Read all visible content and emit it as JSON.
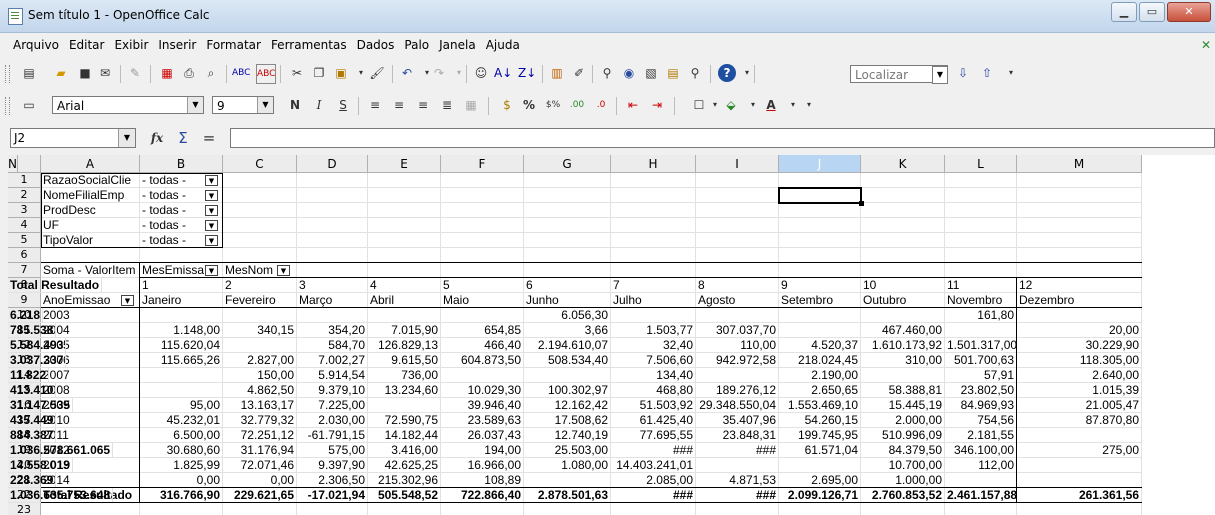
{
  "window": {
    "title": "Sem título 1 - OpenOffice Calc",
    "min": "▁",
    "max": "▭",
    "close": "✕"
  },
  "menu": [
    "Arquivo",
    "Editar",
    "Exibir",
    "Inserir",
    "Formatar",
    "Ferramentas",
    "Dados",
    "Palo",
    "Janela",
    "Ajuda"
  ],
  "toolbar": {
    "find_placeholder": "Localizar",
    "font_name": "Arial",
    "font_size": "9"
  },
  "formula": {
    "cell_ref": "J2",
    "content": ""
  },
  "columns": [
    "A",
    "B",
    "C",
    "D",
    "E",
    "F",
    "G",
    "H",
    "I",
    "J",
    "K",
    "L",
    "M",
    "N"
  ],
  "selected_column": "J",
  "filters": [
    {
      "label": "RazaoSocialClie",
      "value": "- todas -"
    },
    {
      "label": "NomeFilialEmp",
      "value": "- todas -"
    },
    {
      "label": "ProdDesc",
      "value": "- todas -"
    },
    {
      "label": "UF",
      "value": "- todas -"
    },
    {
      "label": "TipoValor",
      "value": "- todas -"
    }
  ],
  "pivot": {
    "data_label": "Soma - ValorItem",
    "col_field1": "MesEmissa",
    "col_field2": "MesNom",
    "row_field": "AnoEmissao",
    "month_numbers": [
      "1",
      "2",
      "3",
      "4",
      "5",
      "6",
      "7",
      "8",
      "9",
      "10",
      "11",
      "12"
    ],
    "month_names": [
      "Janeiro",
      "Fevereiro",
      "Março",
      "Abril",
      "Maio",
      "Junho",
      "Julho",
      "Agosto",
      "Setembro",
      "Outubro",
      "Novembro",
      "Dezembro"
    ],
    "total_header": "Total Resultado",
    "rows": [
      {
        "year": "2003",
        "values": [
          "",
          "",
          "",
          "",
          "",
          "6.056,30",
          "",
          "",
          "",
          "",
          "161,80",
          ""
        ],
        "total": "6.218"
      },
      {
        "year": "2004",
        "values": [
          "1.148,00",
          "340,15",
          "354,20",
          "7.015,90",
          "654,85",
          "3,66",
          "1.503,77",
          "307.037,70",
          "",
          "467.460,00",
          "",
          "20,00"
        ],
        "total": "785.538"
      },
      {
        "year": "2005",
        "values": [
          "115.620,04",
          "",
          "584,70",
          "126.829,13",
          "466,40",
          "2.194.610,07",
          "32,40",
          "110,00",
          "4.520,37",
          "1.610.173,92",
          "1.501.317,00",
          "30.229,90"
        ],
        "total": "5.584.493"
      },
      {
        "year": "2006",
        "values": [
          "115.665,26",
          "2.827,00",
          "7.002,27",
          "9.615,50",
          "604.873,50",
          "508.534,40",
          "7.506,60",
          "942.972,58",
          "218.024,45",
          "310,00",
          "501.700,63",
          "118.305,00"
        ],
        "total": "3.037.337"
      },
      {
        "year": "2007",
        "values": [
          "",
          "150,00",
          "5.914,54",
          "736,00",
          "",
          "",
          "134,40",
          "",
          "2.190,00",
          "",
          "57,91",
          "2.640,00"
        ],
        "total": "11.822"
      },
      {
        "year": "2008",
        "values": [
          "",
          "4.862,50",
          "9.379,10",
          "13.234,60",
          "10.029,30",
          "100.302,97",
          "468,80",
          "189.276,12",
          "2.650,65",
          "58.388,81",
          "23.802,50",
          "1.015,39"
        ],
        "total": "413.410"
      },
      {
        "year": "2009",
        "values": [
          "95,00",
          "13.163,17",
          "7.225,00",
          "",
          "39.946,40",
          "12.162,42",
          "51.503,92",
          "29.348.550,04",
          "1.553.469,10",
          "15.445,19",
          "84.969,93",
          "21.005,47"
        ],
        "total": "31.147.535"
      },
      {
        "year": "2010",
        "values": [
          "45.232,01",
          "32.779,32",
          "2.030,00",
          "72.590,75",
          "23.589,63",
          "17.508,62",
          "61.425,40",
          "35.407,96",
          "54.260,15",
          "2.000,00",
          "754,56",
          "87.870,80"
        ],
        "total": "435.449"
      },
      {
        "year": "2011",
        "values": [
          "6.500,00",
          "72.251,12",
          "-61.791,15",
          "14.182,44",
          "26.037,43",
          "12.740,19",
          "77.695,55",
          "23.848,31",
          "199.745,95",
          "510.996,09",
          "2.181,55",
          ""
        ],
        "total": "884.387"
      },
      {
        "year": "2012",
        "values": [
          "30.680,60",
          "31.176,94",
          "575,00",
          "3.416,00",
          "194,00",
          "25.503,00",
          "###",
          "###",
          "61.571,04",
          "84.379,50",
          "346.100,00",
          "275,00"
        ],
        "total": "1.036.578.661.065"
      },
      {
        "year": "2013",
        "values": [
          "1.825,99",
          "72.071,46",
          "9.397,90",
          "42.625,25",
          "16.966,00",
          "1.080,00",
          "14.403.241,01",
          "",
          "",
          "10.700,00",
          "112,00",
          ""
        ],
        "total": "14.558.019"
      },
      {
        "year": "2014",
        "values": [
          "0,00",
          "0,00",
          "2.306,50",
          "215.302,96",
          "108,89",
          "",
          "2.085,00",
          "4.871,53",
          "2.695,00",
          "1.000,00",
          "",
          ""
        ],
        "total": "228.369"
      }
    ],
    "grand_total": {
      "label": "Total Resultado",
      "values": [
        "316.766,90",
        "229.621,65",
        "-17.021,94",
        "505.548,52",
        "722.866,40",
        "2.878.501,63",
        "###",
        "###",
        "2.099.126,71",
        "2.760.853,52",
        "2.461.157,88",
        "261.361,56"
      ],
      "total": "1.036.635.753.648"
    }
  },
  "row_numbers": [
    "1",
    "2",
    "3",
    "4",
    "5",
    "6",
    "7",
    "8",
    "9",
    "10",
    "11",
    "12",
    "13",
    "14",
    "15",
    "16",
    "17",
    "18",
    "19",
    "20",
    "21",
    "22",
    "23"
  ]
}
